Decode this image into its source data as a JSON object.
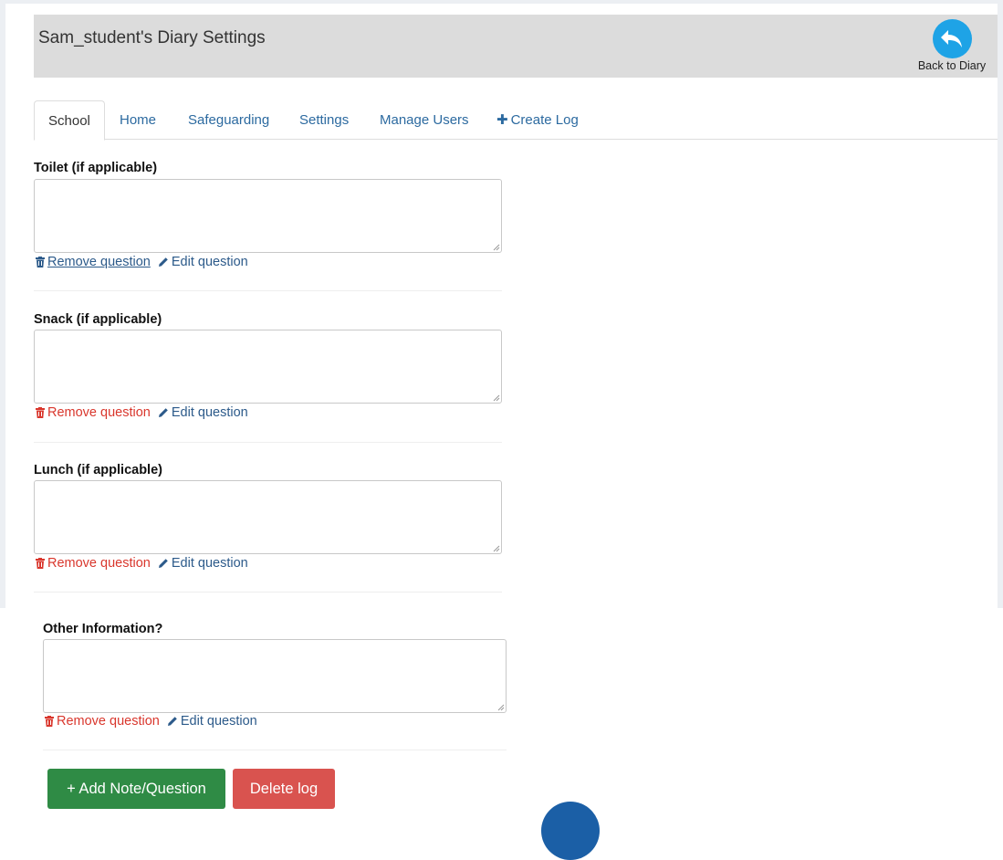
{
  "header": {
    "title": "Sam_student's Diary Settings",
    "back_label": "Back to Diary"
  },
  "tabs": [
    {
      "label": "School",
      "active": true
    },
    {
      "label": "Home"
    },
    {
      "label": "Safeguarding"
    },
    {
      "label": "Settings"
    },
    {
      "label": "Manage Users"
    },
    {
      "label": "Create Log",
      "icon": "plus-icon"
    }
  ],
  "questions": [
    {
      "label": "Toilet (if applicable)",
      "answer": "",
      "remove_label": "Remove question",
      "edit_label": "Edit question"
    },
    {
      "label": "Snack (if applicable)",
      "answer": "",
      "remove_label": "Remove question",
      "edit_label": "Edit question"
    },
    {
      "label": "Lunch (if applicable)",
      "answer": "",
      "remove_label": "Remove question",
      "edit_label": "Edit question"
    },
    {
      "label": "Other Information?",
      "answer": "",
      "remove_label": "Remove question",
      "edit_label": "Edit question"
    }
  ],
  "buttons": {
    "add": "+ Add Note/Question",
    "delete": "Delete log"
  },
  "colors": {
    "accent_blue": "#2c6aa0",
    "remove_red": "#d9372d",
    "add_green": "#2f8b45",
    "delete_red": "#d9534f",
    "back_icon_blue": "#1ea3e6"
  }
}
